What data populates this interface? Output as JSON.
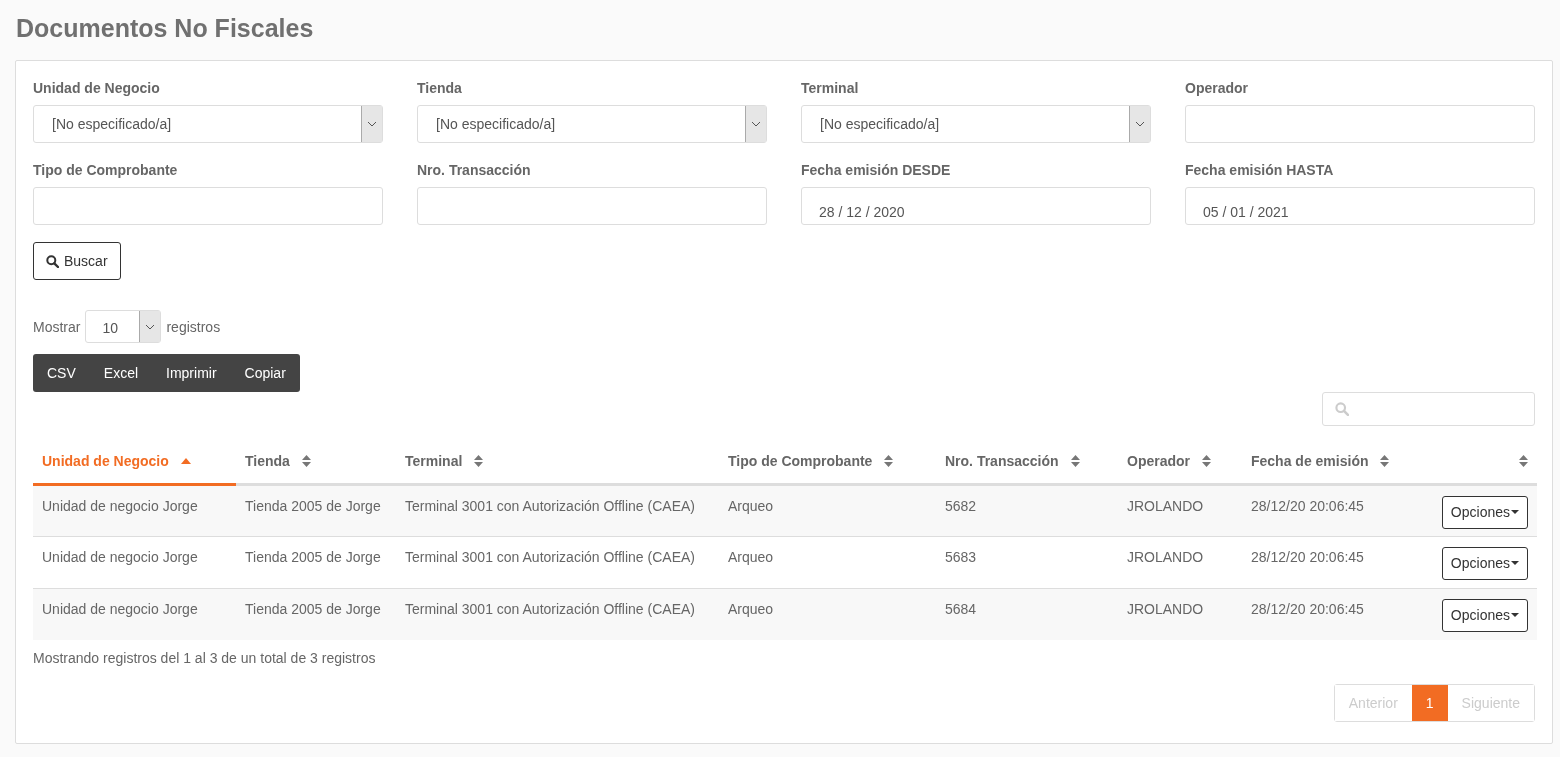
{
  "title": "Documentos No Fiscales",
  "filters": [
    {
      "label": "Unidad de Negocio",
      "kind": "select",
      "value": "[No especificado/a]"
    },
    {
      "label": "Tienda",
      "kind": "select",
      "value": "[No especificado/a]"
    },
    {
      "label": "Terminal",
      "kind": "select",
      "value": "[No especificado/a]"
    },
    {
      "label": "Operador",
      "kind": "input"
    },
    {
      "label": "Tipo de Comprobante",
      "kind": "input"
    },
    {
      "label": "Nro. Transacción",
      "kind": "input"
    },
    {
      "label": "Fecha emisión DESDE",
      "kind": "input",
      "value": "28 / 12 / 2020"
    },
    {
      "label": "Fecha emisión HASTA",
      "kind": "input",
      "value": "05 / 01 / 2021"
    }
  ],
  "search_button": "Buscar",
  "length": {
    "before": "Mostrar",
    "value": "10",
    "after": "registros"
  },
  "export_buttons": [
    "CSV",
    "Excel",
    "Imprimir",
    "Copiar"
  ],
  "table": {
    "columns": [
      {
        "label": "Unidad de Negocio",
        "kind": "ascending",
        "selected": true
      },
      {
        "label": "Tienda",
        "kind": "sortable",
        "selected": false
      },
      {
        "label": "Terminal",
        "kind": "sortable",
        "selected": false
      },
      {
        "label": "Tipo de Comprobante",
        "kind": "sortable",
        "selected": false
      },
      {
        "label": "Nro. Transacción",
        "kind": "sortable",
        "selected": false
      },
      {
        "label": "Operador",
        "kind": "sortable",
        "selected": false
      },
      {
        "label": "Fecha de emisión",
        "kind": "sortable",
        "selected": false
      },
      {
        "kind": "sortable",
        "selected": false
      }
    ],
    "rows": [
      {
        "cells": [
          "Unidad de negocio Jorge",
          "Tienda 2005 de Jorge",
          "Terminal 3001 con Autorización Offline (CAEA)",
          "Arqueo",
          "5682",
          "JROLANDO",
          "28/12/20 20:06:45"
        ],
        "action": "Opciones"
      },
      {
        "cells": [
          "Unidad de negocio Jorge",
          "Tienda 2005 de Jorge",
          "Terminal 3001 con Autorización Offline (CAEA)",
          "Arqueo",
          "5683",
          "JROLANDO",
          "28/12/20 20:06:45"
        ],
        "action": "Opciones"
      },
      {
        "cells": [
          "Unidad de negocio Jorge",
          "Tienda 2005 de Jorge",
          "Terminal 3001 con Autorización Offline (CAEA)",
          "Arqueo",
          "5684",
          "JROLANDO",
          "28/12/20 20:06:45"
        ],
        "action": "Opciones"
      }
    ]
  },
  "info": "Mostrando registros del 1 al 3 de un total de 3 registros",
  "pagination": [
    {
      "label": "Anterior",
      "selected": false,
      "disabled": true
    },
    {
      "label": "1",
      "selected": true,
      "disabled": false
    },
    {
      "label": "Siguiente",
      "selected": false,
      "disabled": true
    }
  ]
}
